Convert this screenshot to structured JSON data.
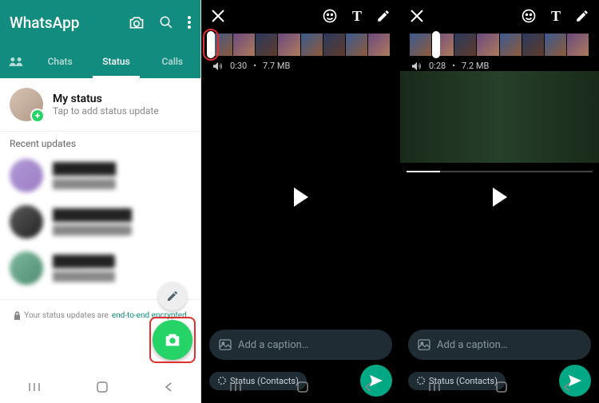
{
  "panel1": {
    "app_title": "WhatsApp",
    "tabs": {
      "chats": "Chats",
      "status": "Status",
      "calls": "Calls"
    },
    "mystatus": {
      "title": "My status",
      "subtitle": "Tap to add status update"
    },
    "recent_label": "Recent updates",
    "contacts": [
      {
        "name": "████████",
        "sub": "██████████"
      },
      {
        "name": "██████████",
        "sub": "████████████"
      },
      {
        "name": "████",
        "sub": "██████████"
      }
    ],
    "encrypted_prefix": "Your status updates are ",
    "encrypted_link": "end-to-end encrypted"
  },
  "panel2": {
    "duration": "0:30",
    "size": "7.7 MB",
    "caption_placeholder": "Add a caption…",
    "recipient": "Status (Contacts)"
  },
  "panel3": {
    "duration": "0:28",
    "size": "7.2 MB",
    "caption_placeholder": "Add a caption…",
    "recipient": "Status (Contacts)"
  }
}
